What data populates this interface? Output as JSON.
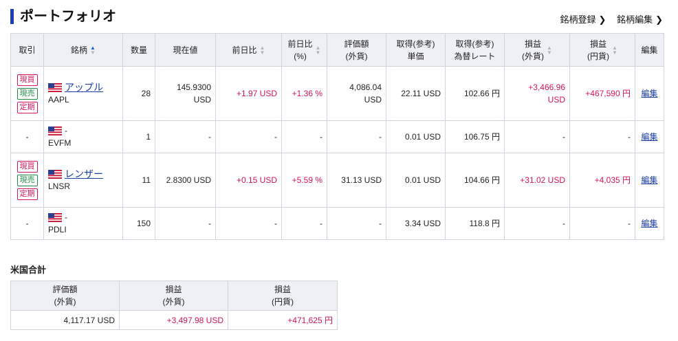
{
  "header": {
    "title": "ポートフォリオ",
    "links": [
      {
        "label": "銘柄登録",
        "icon": "chevron-right"
      },
      {
        "label": "銘柄編集",
        "icon": "chevron-right"
      }
    ]
  },
  "table": {
    "headers": {
      "trade": "取引",
      "name": "銘柄",
      "qty": "数量",
      "price": "現在値",
      "change": "前日比",
      "change_pct_1": "前日比",
      "change_pct_2": "(%)",
      "value_1": "評価額",
      "value_2": "(外貨)",
      "cost_1": "取得(参考)",
      "cost_2": "単価",
      "rate_1": "取得(参考)",
      "rate_2": "為替レート",
      "pl_fx_1": "損益",
      "pl_fx_2": "(外貨)",
      "pl_jpy_1": "損益",
      "pl_jpy_2": "(円貨)",
      "edit": "編集"
    },
    "badge_labels": {
      "buy": "現買",
      "sell": "現売",
      "term": "定期"
    },
    "rows": [
      {
        "trade": "",
        "name": "アップル",
        "code": "AAPL",
        "qty": "28",
        "price_1": "145.9300",
        "price_2": "USD",
        "change": "+1.97 USD",
        "change_pct": "+1.36 %",
        "value_1": "4,086.04",
        "value_2": "USD",
        "cost": "22.11 USD",
        "rate": "102.66 円",
        "pl_fx_1": "+3,466.96",
        "pl_fx_2": "USD",
        "pl_jpy": "+467,590 円",
        "edit": "編集"
      },
      {
        "trade": "-",
        "name": "-",
        "code": "EVFM",
        "qty": "1",
        "price_1": "-",
        "price_2": "",
        "change": "-",
        "change_pct": "-",
        "value_1": "-",
        "value_2": "",
        "cost": "0.01 USD",
        "rate": "106.75 円",
        "pl_fx_1": "-",
        "pl_fx_2": "",
        "pl_jpy": "-",
        "edit": "編集"
      },
      {
        "trade": "",
        "name": "レンザー",
        "code": "LNSR",
        "qty": "11",
        "price_1": "2.8300 USD",
        "price_2": "",
        "change": "+0.15 USD",
        "change_pct": "+5.59 %",
        "value_1": "31.13 USD",
        "value_2": "",
        "cost": "0.01 USD",
        "rate": "104.66 円",
        "pl_fx_1": "+31.02 USD",
        "pl_fx_2": "",
        "pl_jpy": "+4,035 円",
        "edit": "編集"
      },
      {
        "trade": "-",
        "name": "-",
        "code": "PDLI",
        "qty": "150",
        "price_1": "-",
        "price_2": "",
        "change": "-",
        "change_pct": "-",
        "value_1": "-",
        "value_2": "",
        "cost": "3.34 USD",
        "rate": "118.8 円",
        "pl_fx_1": "-",
        "pl_fx_2": "",
        "pl_jpy": "-",
        "edit": "編集"
      }
    ]
  },
  "totals": {
    "title": "米国合計",
    "headers": {
      "value_1": "評価額",
      "value_2": "(外貨)",
      "pl_fx_1": "損益",
      "pl_fx_2": "(外貨)",
      "pl_jpy_1": "損益",
      "pl_jpy_2": "(円貨)"
    },
    "values": {
      "value": "4,117.17 USD",
      "pl_fx": "+3,497.98 USD",
      "pl_jpy": "+471,625 円"
    }
  },
  "colors": {
    "accent": "#1a3fb8",
    "positive": "#d4145a",
    "sell": "#1f8a45",
    "link": "#1b3fa0",
    "header_bg": "#eef0f5"
  }
}
